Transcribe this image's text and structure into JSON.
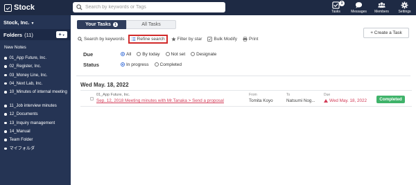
{
  "app": {
    "name": "Stock"
  },
  "search": {
    "placeholder": "Search by keywords or Tags"
  },
  "nav": {
    "items": [
      {
        "label": "Tasks",
        "icon": "checkbox-icon",
        "badge": "1"
      },
      {
        "label": "Messages",
        "icon": "chat-icon"
      },
      {
        "label": "Members",
        "icon": "members-icon"
      },
      {
        "label": "Settings",
        "icon": "gear-icon"
      }
    ]
  },
  "sidebar": {
    "company": "Stock, Inc.",
    "folders_label": "Folders",
    "folders_count": "(11)",
    "add_label": "+",
    "new_notes": "New Notes",
    "folders": [
      "01_App Future, Inc.",
      "02_Register, Inc.",
      "03_Money Line, Inc.",
      "04_Next Lab, Inc.",
      "10_Minutes of internal meeting",
      "11_Job interview minutes",
      "12_Documents",
      "13_Inquiry management",
      "14_Manual",
      "Team Folder",
      "マイフォルダ"
    ]
  },
  "main": {
    "tabs": [
      {
        "label": "Your Tasks",
        "badge": "1",
        "active": true
      },
      {
        "label": "All Tasks",
        "active": false
      }
    ],
    "create_button": "+ Create a Task",
    "toolbar": {
      "search_keywords": "Search by keywords",
      "refine_search": "Refine search",
      "filter_star": "Filter by star",
      "bulk_modify": "Bulk Modify",
      "print": "Print"
    },
    "filters": {
      "due_label": "Due",
      "due_options": [
        "All",
        "By today",
        "Not set",
        "Designate"
      ],
      "due_selected": "All",
      "status_label": "Status",
      "status_options": [
        "In progress",
        "Completed"
      ],
      "status_selected": "In progress"
    },
    "date_header": "Wed May. 18, 2022",
    "task": {
      "folder": "01_App Future, Inc.",
      "title": "Sep. 12, 2018 Meeting minutes with Mr.Tanaka > Send a proposal",
      "from_label": "From",
      "from": "Tomita Koyo",
      "to_label": "To",
      "to": "Natsumi Nog...",
      "due_label": "Due",
      "due": "Wed May. 18, 2022",
      "status": "Completed"
    }
  },
  "colors": {
    "topbar": "#1e2a44",
    "sidebar": "#253454",
    "highlight": "#d12a2a",
    "overdue": "#d23b57",
    "completed": "#3fb36a"
  }
}
